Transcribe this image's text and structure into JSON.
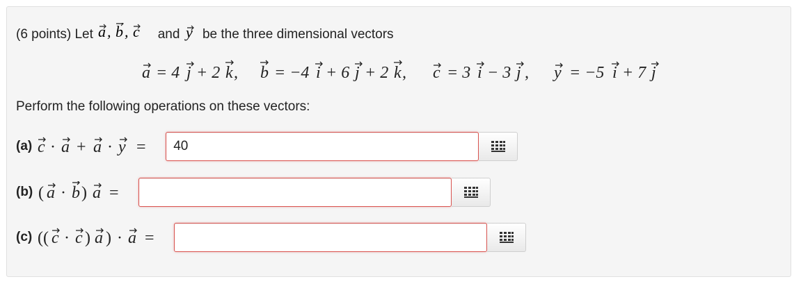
{
  "problem": {
    "intro": "(6 points) Let",
    "intro_vars": "a, b, c",
    "intro_and": "and",
    "intro_end": "be the three dimensional vectors",
    "display_equation": "a = 4j + 2k,   b = −4i + 6j + 2k,   c = 3i − 3j,   y = −5i + 7j",
    "instruction": "Perform the following operations on these vectors:"
  },
  "parts": [
    {
      "label": "(a)",
      "expression": "c · a + a · y =",
      "value": "40",
      "placeholder": ""
    },
    {
      "label": "(b)",
      "expression": "(a · b) a =",
      "value": "",
      "placeholder": ""
    },
    {
      "label": "(c)",
      "expression": "((c · c) a) · a =",
      "value": "",
      "placeholder": ""
    }
  ],
  "colors": {
    "error_border": "#d9534f",
    "panel_background": "#f5f5f5"
  },
  "icons": {
    "math_editor": "keypad-grid-icon"
  }
}
